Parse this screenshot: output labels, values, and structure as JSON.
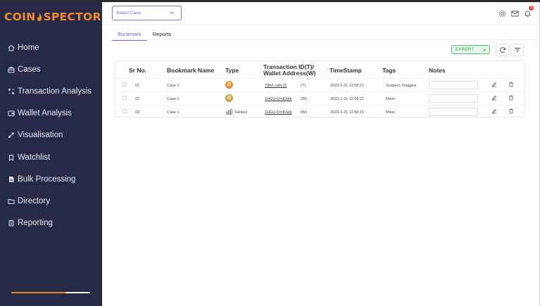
{
  "sidebar": {
    "logo_left": "COIN",
    "logo_right": "SPECTOR",
    "items": [
      {
        "label": "Home",
        "icon": "home-icon"
      },
      {
        "label": "Cases",
        "icon": "cases-icon"
      },
      {
        "label": "Transaction Analysis",
        "icon": "transaction-icon"
      },
      {
        "label": "Wallet Analysis",
        "icon": "wallet-icon"
      },
      {
        "label": "Visualisation",
        "icon": "visualisation-icon"
      },
      {
        "label": "Watchlist",
        "icon": "watchlist-icon"
      },
      {
        "label": "Bulk Processing",
        "icon": "bulk-icon"
      },
      {
        "label": "Directory",
        "icon": "folder-icon"
      },
      {
        "label": "Reporting",
        "icon": "reporting-icon"
      }
    ],
    "progress": 0.7
  },
  "topbar": {
    "case_placeholder": "Select Case",
    "notification_count": "3"
  },
  "tabs": [
    {
      "label": "Bookmark",
      "active": true
    },
    {
      "label": "Reports",
      "active": false
    }
  ],
  "toolbar": {
    "export_label": "EXPORT"
  },
  "table": {
    "headers": {
      "sr": "Sr No.",
      "name": "Bookmark Name",
      "type": "Type",
      "txid_1": "Transaction ID(T)/",
      "txid_2": "Wallet Address(W)",
      "timestamp": "TimeStamp",
      "tags": "Tags",
      "notes": "Notes"
    },
    "rows": [
      {
        "sr": "01",
        "name": "Case 1",
        "type": "bitcoin",
        "type_label": "",
        "id": "79b2-ca6c11",
        "kind": "(T)",
        "timestamp": "2023-1-31 12:58:21",
        "tags": "Suspect, Flagged"
      },
      {
        "sr": "02",
        "name": "Case 1",
        "type": "dogecoin",
        "type_label": "",
        "id": "1HGU-Cm8Jwb",
        "kind": "(W)",
        "timestamp": "2023-1-31 12:58:21",
        "tags": "Mixer"
      },
      {
        "sr": "03",
        "name": "Case 1",
        "type": "sankey",
        "type_label": "Sankey",
        "id": "1HGU-Cm8Jwb",
        "kind": "(W)",
        "timestamp": "2023-1-31 12:58:21",
        "tags": "Mixer"
      }
    ]
  },
  "colors": {
    "sidebar_bg": "#262a47",
    "accent": "#6d68d6",
    "brand_orange": "#f08a2a",
    "export_green": "#4fbf6a"
  }
}
